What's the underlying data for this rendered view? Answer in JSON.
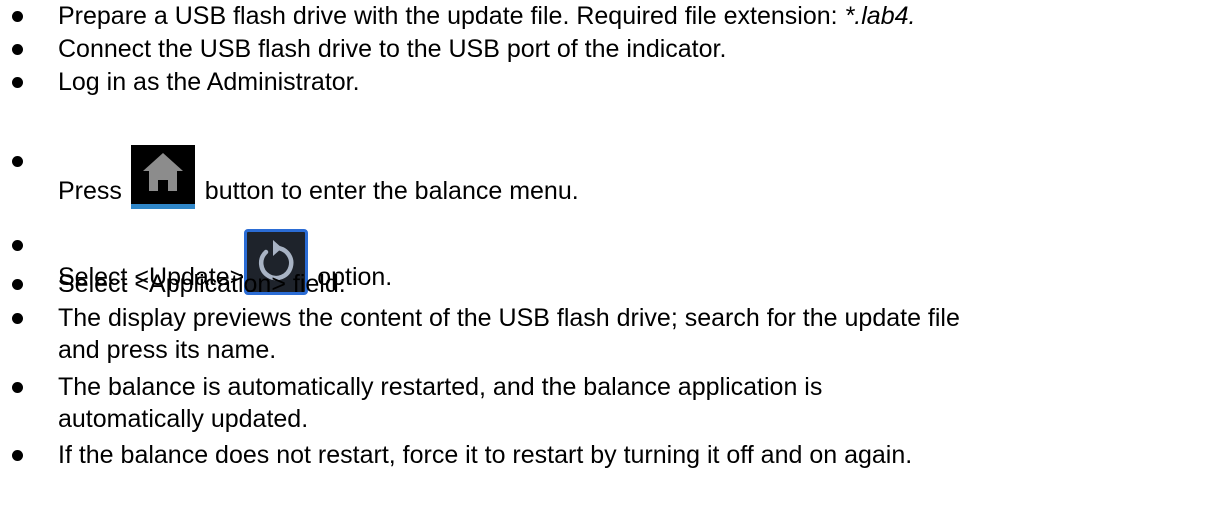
{
  "items": [
    {
      "text": "Prepare a USB flash drive with the update file. Required file extension:  ",
      "ext": "*.lab4."
    },
    {
      "text": "Connect the USB flash drive to the USB port of the indicator."
    },
    {
      "text": "Log in as the Administrator."
    },
    {
      "before": "Press ",
      "after": " button to enter the balance menu.",
      "icon": "home-icon"
    },
    {
      "before": "Select <Update>",
      "after": " option.",
      "icon": "update-restart-icon"
    },
    {
      "text": "Select <Application> field."
    },
    {
      "line1": "The display previews the content of the USB flash drive; search for the update file",
      "line2": "and press its name."
    },
    {
      "line1": "The balance is automatically restarted, and the balance application is",
      "line2": "automatically updated."
    },
    {
      "text": "If the balance does not restart, force it to restart by turning it off and on again."
    }
  ],
  "colors": {
    "home_button_bg": "#000000",
    "home_icon": "#8c8c8c",
    "home_underline": "#2f86c8",
    "update_button_bg": "#1e232b",
    "update_button_border": "#2b6cd4",
    "update_icon": "#a8b3c4"
  }
}
